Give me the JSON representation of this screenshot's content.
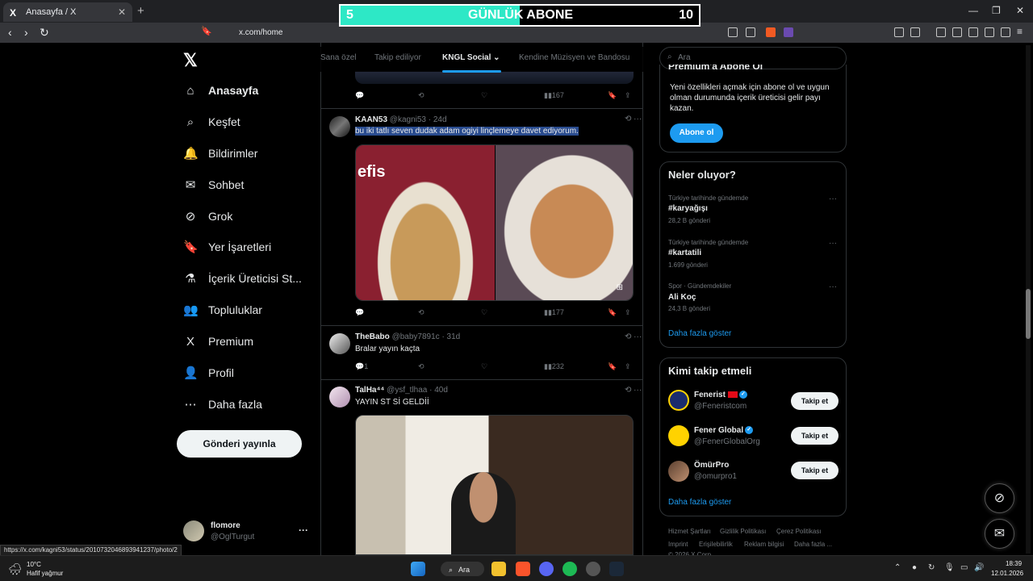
{
  "browser": {
    "tab_title": "Anasayfa / X",
    "tab_icon": "X",
    "url": "x.com/home",
    "status_url": "https://x.com/kagni53/status/2010732046893941237/photo/2"
  },
  "overlay": {
    "left_num": "5",
    "title": "GÜNLÜK ABONE",
    "right_num": "10",
    "progress": 0.5
  },
  "nav": {
    "items": [
      {
        "label": "Anasayfa",
        "icon": "⌂"
      },
      {
        "label": "Keşfet",
        "icon": "⌕"
      },
      {
        "label": "Bildirimler",
        "icon": "🔔"
      },
      {
        "label": "Sohbet",
        "icon": "✉"
      },
      {
        "label": "Grok",
        "icon": "⊘"
      },
      {
        "label": "Yer İşaretleri",
        "icon": "🔖"
      },
      {
        "label": "İçerik Üreticisi St...",
        "icon": "⚗"
      },
      {
        "label": "Topluluklar",
        "icon": "👥"
      },
      {
        "label": "Premium",
        "icon": "X"
      },
      {
        "label": "Profil",
        "icon": "👤"
      },
      {
        "label": "Daha fazla",
        "icon": "⋯"
      }
    ],
    "post_button": "Gönderi yayınla",
    "me_name": "flomore",
    "me_handle": "@OglTurgut"
  },
  "timeline": {
    "tabs": [
      "Sana özel",
      "Takip ediliyor",
      "KNGL Social",
      "Kendine Müzisyen ve Bandosu"
    ],
    "top_views": "167",
    "posts": [
      {
        "name": "KAAN53",
        "handle": "@kagni53",
        "age": "· 24d",
        "text": "bu iki tatlı seven dudak adam ogiyi linçlemeye davet ediyorum.",
        "replies": "",
        "views": "177"
      },
      {
        "name": "TheBabo",
        "handle": "@baby7891c",
        "age": "· 31d",
        "text": "Bralar yayın kaçta",
        "replies": "1",
        "views": "232"
      },
      {
        "name": "TalHa⁴⁴",
        "handle": "@ysf_tlhaa",
        "age": "· 40d",
        "text": "YAYIN ST Sİ GELDİİ",
        "replies": "",
        "views": ""
      }
    ],
    "media_watermark": "efis"
  },
  "right": {
    "search_placeholder": "Ara",
    "premium_title": "Premium'a Abone Ol",
    "premium_text_1": "Yeni özellikleri açmak için abone ol ve uygun",
    "premium_text_2": "olman durumunda içerik üreticisi gelir payı",
    "premium_text_3": "kazan.",
    "premium_button": "Abone ol",
    "trends_title": "Neler oluyor?",
    "trends": [
      {
        "context": "Türkiye tarihinde gündemde",
        "name": "#karyağışı",
        "count": "28,2 B gönderi"
      },
      {
        "context": "Türkiye tarihinde gündemde",
        "name": "#kartatili",
        "count": "1.699 gönderi"
      },
      {
        "context": "Spor · Gündemdekiler",
        "name": "Ali Koç",
        "count": "24,3 B gönderi"
      }
    ],
    "show_more": "Daha fazla göster",
    "follow_title": "Kimi takip etmeli",
    "follow": [
      {
        "name": "Fenerist",
        "handle": "@Feneristcom",
        "button": "Takip et"
      },
      {
        "name": "Fener Global",
        "handle": "@FenerGlobalOrg",
        "button": "Takip et"
      },
      {
        "name": "ÖmürPro",
        "handle": "@omurpro1",
        "button": "Takip et"
      }
    ],
    "footer_1": [
      "Hizmet Şartları",
      "Gizlilik Politikası",
      "Çerez Politikası"
    ],
    "footer_2": [
      "Imprint",
      "Erişilebilirlik",
      "Reklam bilgisi",
      "Daha fazla ..."
    ],
    "footer_3": "© 2026 X Corp."
  },
  "taskbar": {
    "weather_temp": "10°C",
    "weather_desc": "Hafif yağmur",
    "search_label": "Ara",
    "time": "18:39",
    "date": "12.01.2026"
  },
  "colors": {
    "accent": "#1d9bf0",
    "overlay_fill": "#2de8c6",
    "bg": "#000000"
  }
}
